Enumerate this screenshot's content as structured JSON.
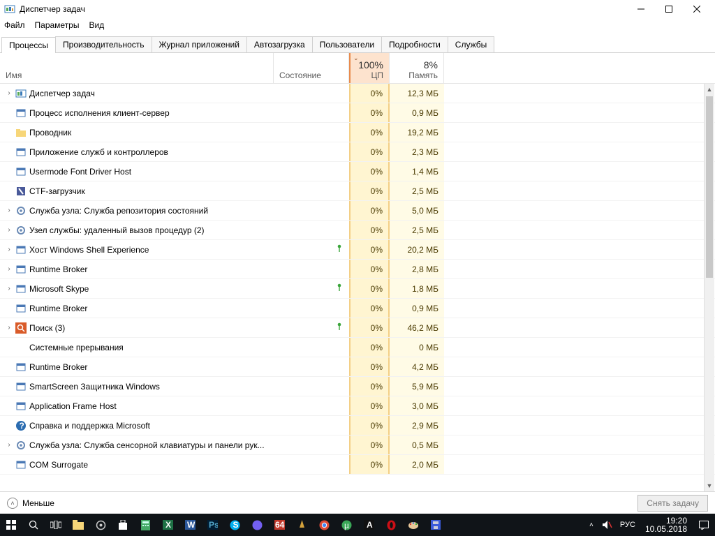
{
  "window": {
    "title": "Диспетчер задач"
  },
  "menu": {
    "file": "Файл",
    "options": "Параметры",
    "view": "Вид"
  },
  "tabs": {
    "processes": "Процессы",
    "performance": "Производительность",
    "apphistory": "Журнал приложений",
    "startup": "Автозагрузка",
    "users": "Пользователи",
    "details": "Подробности",
    "services": "Службы"
  },
  "columns": {
    "name": "Имя",
    "state": "Состояние",
    "cpu_pct": "100%",
    "cpu_label": "ЦП",
    "mem_pct": "8%",
    "mem_label": "Память"
  },
  "processes": [
    {
      "name": "Диспетчер задач",
      "cpu": "0%",
      "mem": "12,3 МБ",
      "expandable": true,
      "icon": "taskmgr",
      "leaf": false
    },
    {
      "name": "Процесс исполнения клиент-сервер",
      "cpu": "0%",
      "mem": "0,9 МБ",
      "expandable": false,
      "icon": "exe",
      "leaf": false
    },
    {
      "name": "Проводник",
      "cpu": "0%",
      "mem": "19,2 МБ",
      "expandable": false,
      "icon": "folder",
      "leaf": false
    },
    {
      "name": "Приложение служб и контроллеров",
      "cpu": "0%",
      "mem": "2,3 МБ",
      "expandable": false,
      "icon": "exe",
      "leaf": false
    },
    {
      "name": "Usermode Font Driver Host",
      "cpu": "0%",
      "mem": "1,4 МБ",
      "expandable": false,
      "icon": "exe",
      "leaf": false
    },
    {
      "name": "CTF-загрузчик",
      "cpu": "0%",
      "mem": "2,5 МБ",
      "expandable": false,
      "icon": "ctf",
      "leaf": false
    },
    {
      "name": "Служба узла: Служба репозитория состояний",
      "cpu": "0%",
      "mem": "5,0 МБ",
      "expandable": true,
      "icon": "gear",
      "leaf": false
    },
    {
      "name": "Узел службы: удаленный вызов процедур (2)",
      "cpu": "0%",
      "mem": "2,5 МБ",
      "expandable": true,
      "icon": "gear",
      "leaf": false
    },
    {
      "name": "Хост Windows Shell Experience",
      "cpu": "0%",
      "mem": "20,2 МБ",
      "expandable": true,
      "icon": "exe",
      "leaf": true
    },
    {
      "name": "Runtime Broker",
      "cpu": "0%",
      "mem": "2,8 МБ",
      "expandable": true,
      "icon": "exe",
      "leaf": false
    },
    {
      "name": "Microsoft Skype",
      "cpu": "0%",
      "mem": "1,8 МБ",
      "expandable": true,
      "icon": "exe",
      "leaf": true
    },
    {
      "name": "Runtime Broker",
      "cpu": "0%",
      "mem": "0,9 МБ",
      "expandable": false,
      "icon": "exe",
      "leaf": false
    },
    {
      "name": "Поиск (3)",
      "cpu": "0%",
      "mem": "46,2 МБ",
      "expandable": true,
      "icon": "search",
      "leaf": true
    },
    {
      "name": "Системные прерывания",
      "cpu": "0%",
      "mem": "0 МБ",
      "expandable": false,
      "icon": "blank",
      "leaf": false
    },
    {
      "name": "Runtime Broker",
      "cpu": "0%",
      "mem": "4,2 МБ",
      "expandable": false,
      "icon": "exe",
      "leaf": false
    },
    {
      "name": "SmartScreen Защитника Windows",
      "cpu": "0%",
      "mem": "5,9 МБ",
      "expandable": false,
      "icon": "exe",
      "leaf": false
    },
    {
      "name": "Application Frame Host",
      "cpu": "0%",
      "mem": "3,0 МБ",
      "expandable": false,
      "icon": "exe",
      "leaf": false
    },
    {
      "name": "Справка и поддержка Microsoft",
      "cpu": "0%",
      "mem": "2,9 МБ",
      "expandable": false,
      "icon": "help",
      "leaf": false
    },
    {
      "name": "Служба узла: Служба сенсорной клавиатуры и панели рук...",
      "cpu": "0%",
      "mem": "0,5 МБ",
      "expandable": true,
      "icon": "gear",
      "leaf": false
    },
    {
      "name": "COM Surrogate",
      "cpu": "0%",
      "mem": "2,0 МБ",
      "expandable": false,
      "icon": "exe",
      "leaf": false
    }
  ],
  "footer": {
    "less": "Меньше",
    "endtask": "Снять задачу"
  },
  "tray": {
    "lang": "РУС",
    "time": "19:20",
    "date": "10.05.2018"
  }
}
